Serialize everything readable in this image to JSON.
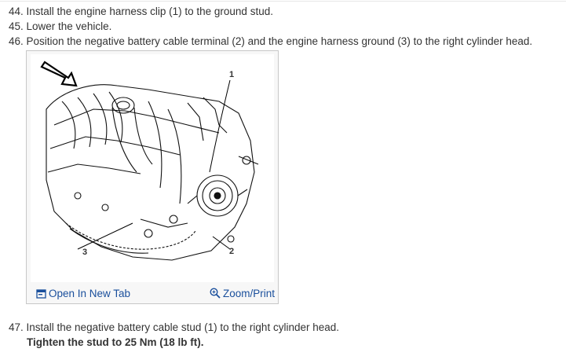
{
  "steps": [
    {
      "text": "44. Install the engine harness clip (1) to the ground stud."
    },
    {
      "text": "45. Lower the vehicle."
    },
    {
      "text": "46. Position the negative battery cable terminal (2) and the engine harness ground (3) to the right cylinder head."
    },
    {
      "text": "47. Install the negative battery cable stud (1) to the right cylinder head."
    }
  ],
  "step47_note": "Tighten the stud to 25 Nm (18 lb ft).",
  "figure": {
    "callouts": [
      "1",
      "2",
      "3"
    ],
    "open_tab_label": "Open In New Tab",
    "zoom_label": "Zoom/Print",
    "open_tab_icon": "open-window-icon",
    "zoom_icon": "magnifier-icon",
    "link_color": "#1a4f9c"
  }
}
